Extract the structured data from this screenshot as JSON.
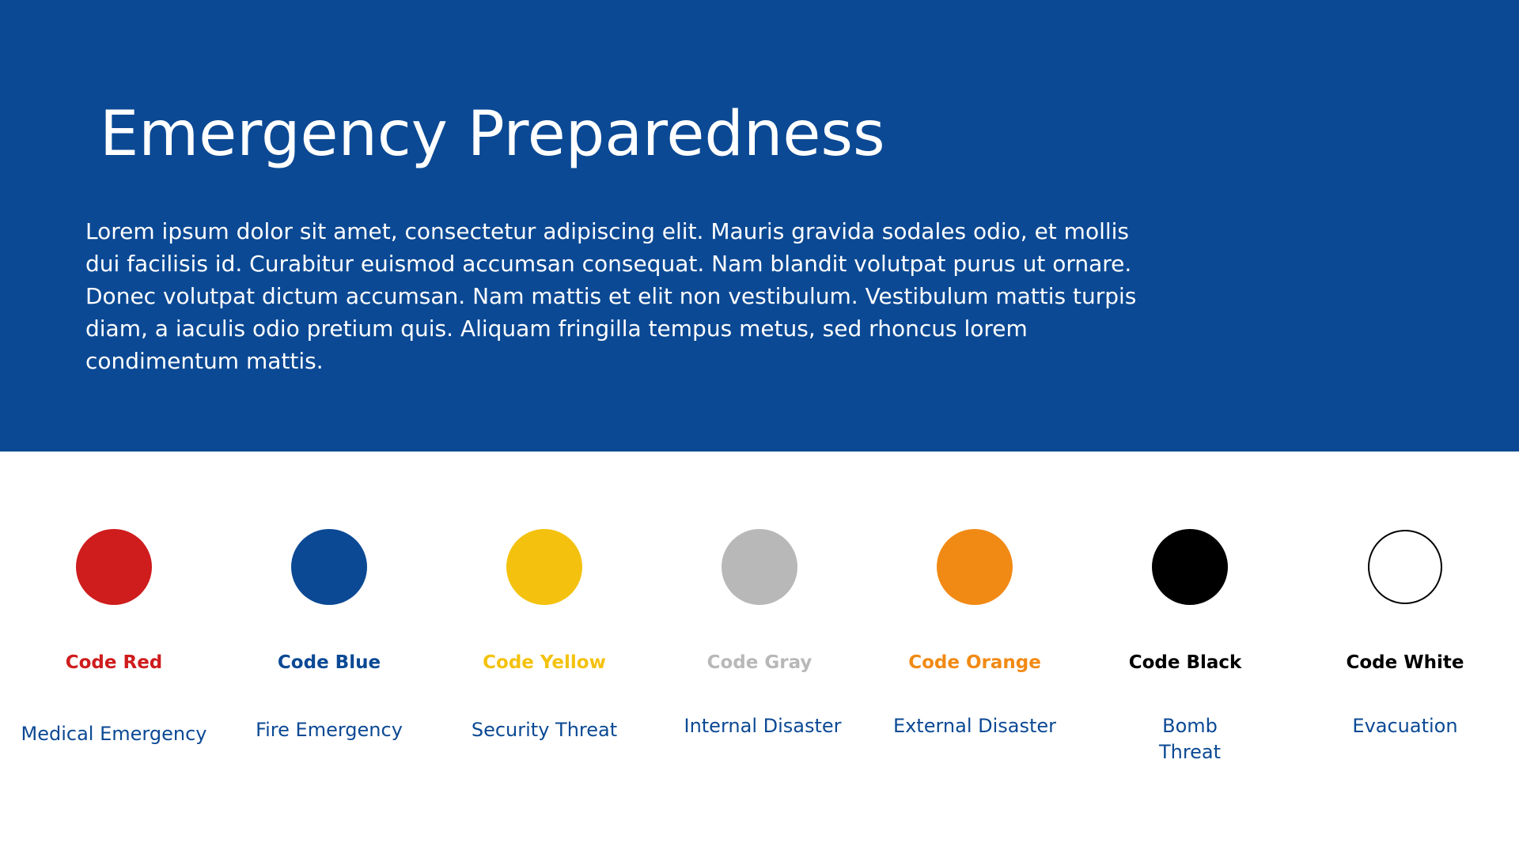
{
  "header": {
    "title": "Emergency Preparedness",
    "body": "Lorem ipsum dolor sit amet, consectetur adipiscing elit. Mauris gravida sodales odio, et mollis dui facilisis id. Curabitur euismod accumsan consequat. Nam blandit volutpat purus ut ornare. Donec volutpat dictum accumsan. Nam mattis et elit non vestibulum. Vestibulum mattis turpis diam, a iaculis odio pretium quis. Aliquam fringilla tempus metus, sed rhoncus lorem condimentum mattis."
  },
  "colors": {
    "banner": "#0b4994",
    "description_text": "#0b4994"
  },
  "codes": [
    {
      "label": "Code Red",
      "description": "Medical Emergency",
      "color": "#cf1c1d",
      "label_color": "#cf1c1d",
      "outline": false
    },
    {
      "label": "Code Blue",
      "description": "Fire Emergency",
      "color": "#0b4994",
      "label_color": "#0b4994",
      "outline": false
    },
    {
      "label": "Code Yellow",
      "description": "Security Threat",
      "color": "#f4c20e",
      "label_color": "#f4c20e",
      "outline": false
    },
    {
      "label": "Code Gray",
      "description": "Internal Disaster",
      "color": "#b8b8b8",
      "label_color": "#b8b8b8",
      "outline": false
    },
    {
      "label": "Code Orange",
      "description": "External Disaster",
      "color": "#f18a14",
      "label_color": "#f18a14",
      "outline": false
    },
    {
      "label": "Code Black",
      "description": "Bomb Threat",
      "color": "#000000",
      "label_color": "#000000",
      "outline": false
    },
    {
      "label": "Code White",
      "description": "Evacuation",
      "color": "#ffffff",
      "label_color": "#000000",
      "outline": true
    }
  ]
}
